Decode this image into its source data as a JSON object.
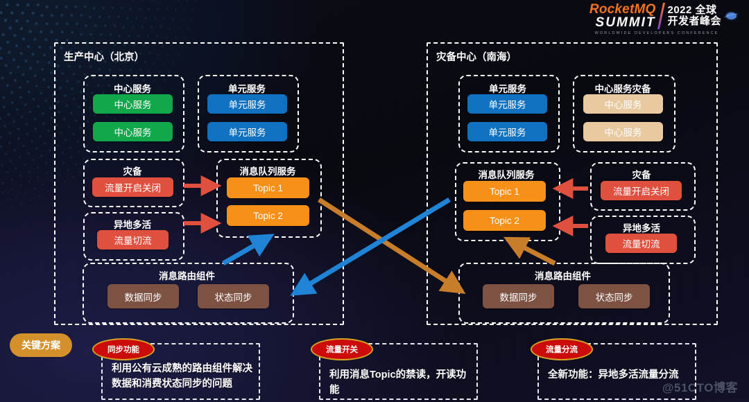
{
  "header": {
    "brand_line1": "RocketMQ",
    "brand_line2": "SUMMIT",
    "year_line1": "2022 全球",
    "year_line2": "开发者峰会",
    "subtitle": "WORLDWIDE DEVELOPERS CONFERENCE",
    "planet_icon": "planet-icon"
  },
  "colors": {
    "green": "#11a84c",
    "blue": "#1071c0",
    "orange": "#f79018",
    "red": "#e0503f",
    "brown": "#7e5243",
    "beige": "#e8c9a0",
    "arrow_blue": "#1f84d6",
    "arrow_orange": "#c87d2a",
    "arrow_red": "#e0503f",
    "pill_amber": "#d4902a",
    "badge_red": "#cc0b0b",
    "badge_border": "#d6a424"
  },
  "left_region": {
    "title": "生产中心（北京）",
    "groups": [
      {
        "title": "中心服务",
        "items": [
          "中心服务",
          "中心服务"
        ]
      },
      {
        "title": "单元服务",
        "items": [
          "单元服务",
          "单元服务"
        ]
      },
      {
        "title": "灾备",
        "items": [
          "流量开启关闭"
        ]
      },
      {
        "title": "消息队列服务",
        "items": [
          "Topic 1",
          "Topic 2"
        ]
      },
      {
        "title": "异地多活",
        "items": [
          "流量切流"
        ]
      },
      {
        "title": "消息路由组件",
        "items": [
          "数据同步",
          "状态同步"
        ]
      }
    ]
  },
  "right_region": {
    "title": "灾备中心（南海）",
    "groups": [
      {
        "title": "单元服务",
        "items": [
          "单元服务",
          "单元服务"
        ]
      },
      {
        "title": "中心服务灾备",
        "items": [
          "中心服务",
          "中心服务"
        ]
      },
      {
        "title": "消息队列服务",
        "items": [
          "Topic 1",
          "Topic 2"
        ]
      },
      {
        "title": "灾备",
        "items": [
          "流量开启关闭"
        ]
      },
      {
        "title": "异地多活",
        "items": [
          "流量切流"
        ]
      },
      {
        "title": "消息路由组件",
        "items": [
          "数据同步",
          "状态同步"
        ]
      }
    ]
  },
  "footer": {
    "pill_label": "关键方案",
    "notes": [
      {
        "badge": "同步功能",
        "line1": "利用公有云成熟的路由组件解决",
        "line2": "数据和消费状态同步的问题"
      },
      {
        "badge": "流量开关",
        "line1": "利用消息Topic的禁读，开读功能",
        "line2": ""
      },
      {
        "badge": "流量分流",
        "line1": "全新功能：异地多活流量分流",
        "line2": ""
      }
    ],
    "watermark": "@51CTO博客"
  }
}
